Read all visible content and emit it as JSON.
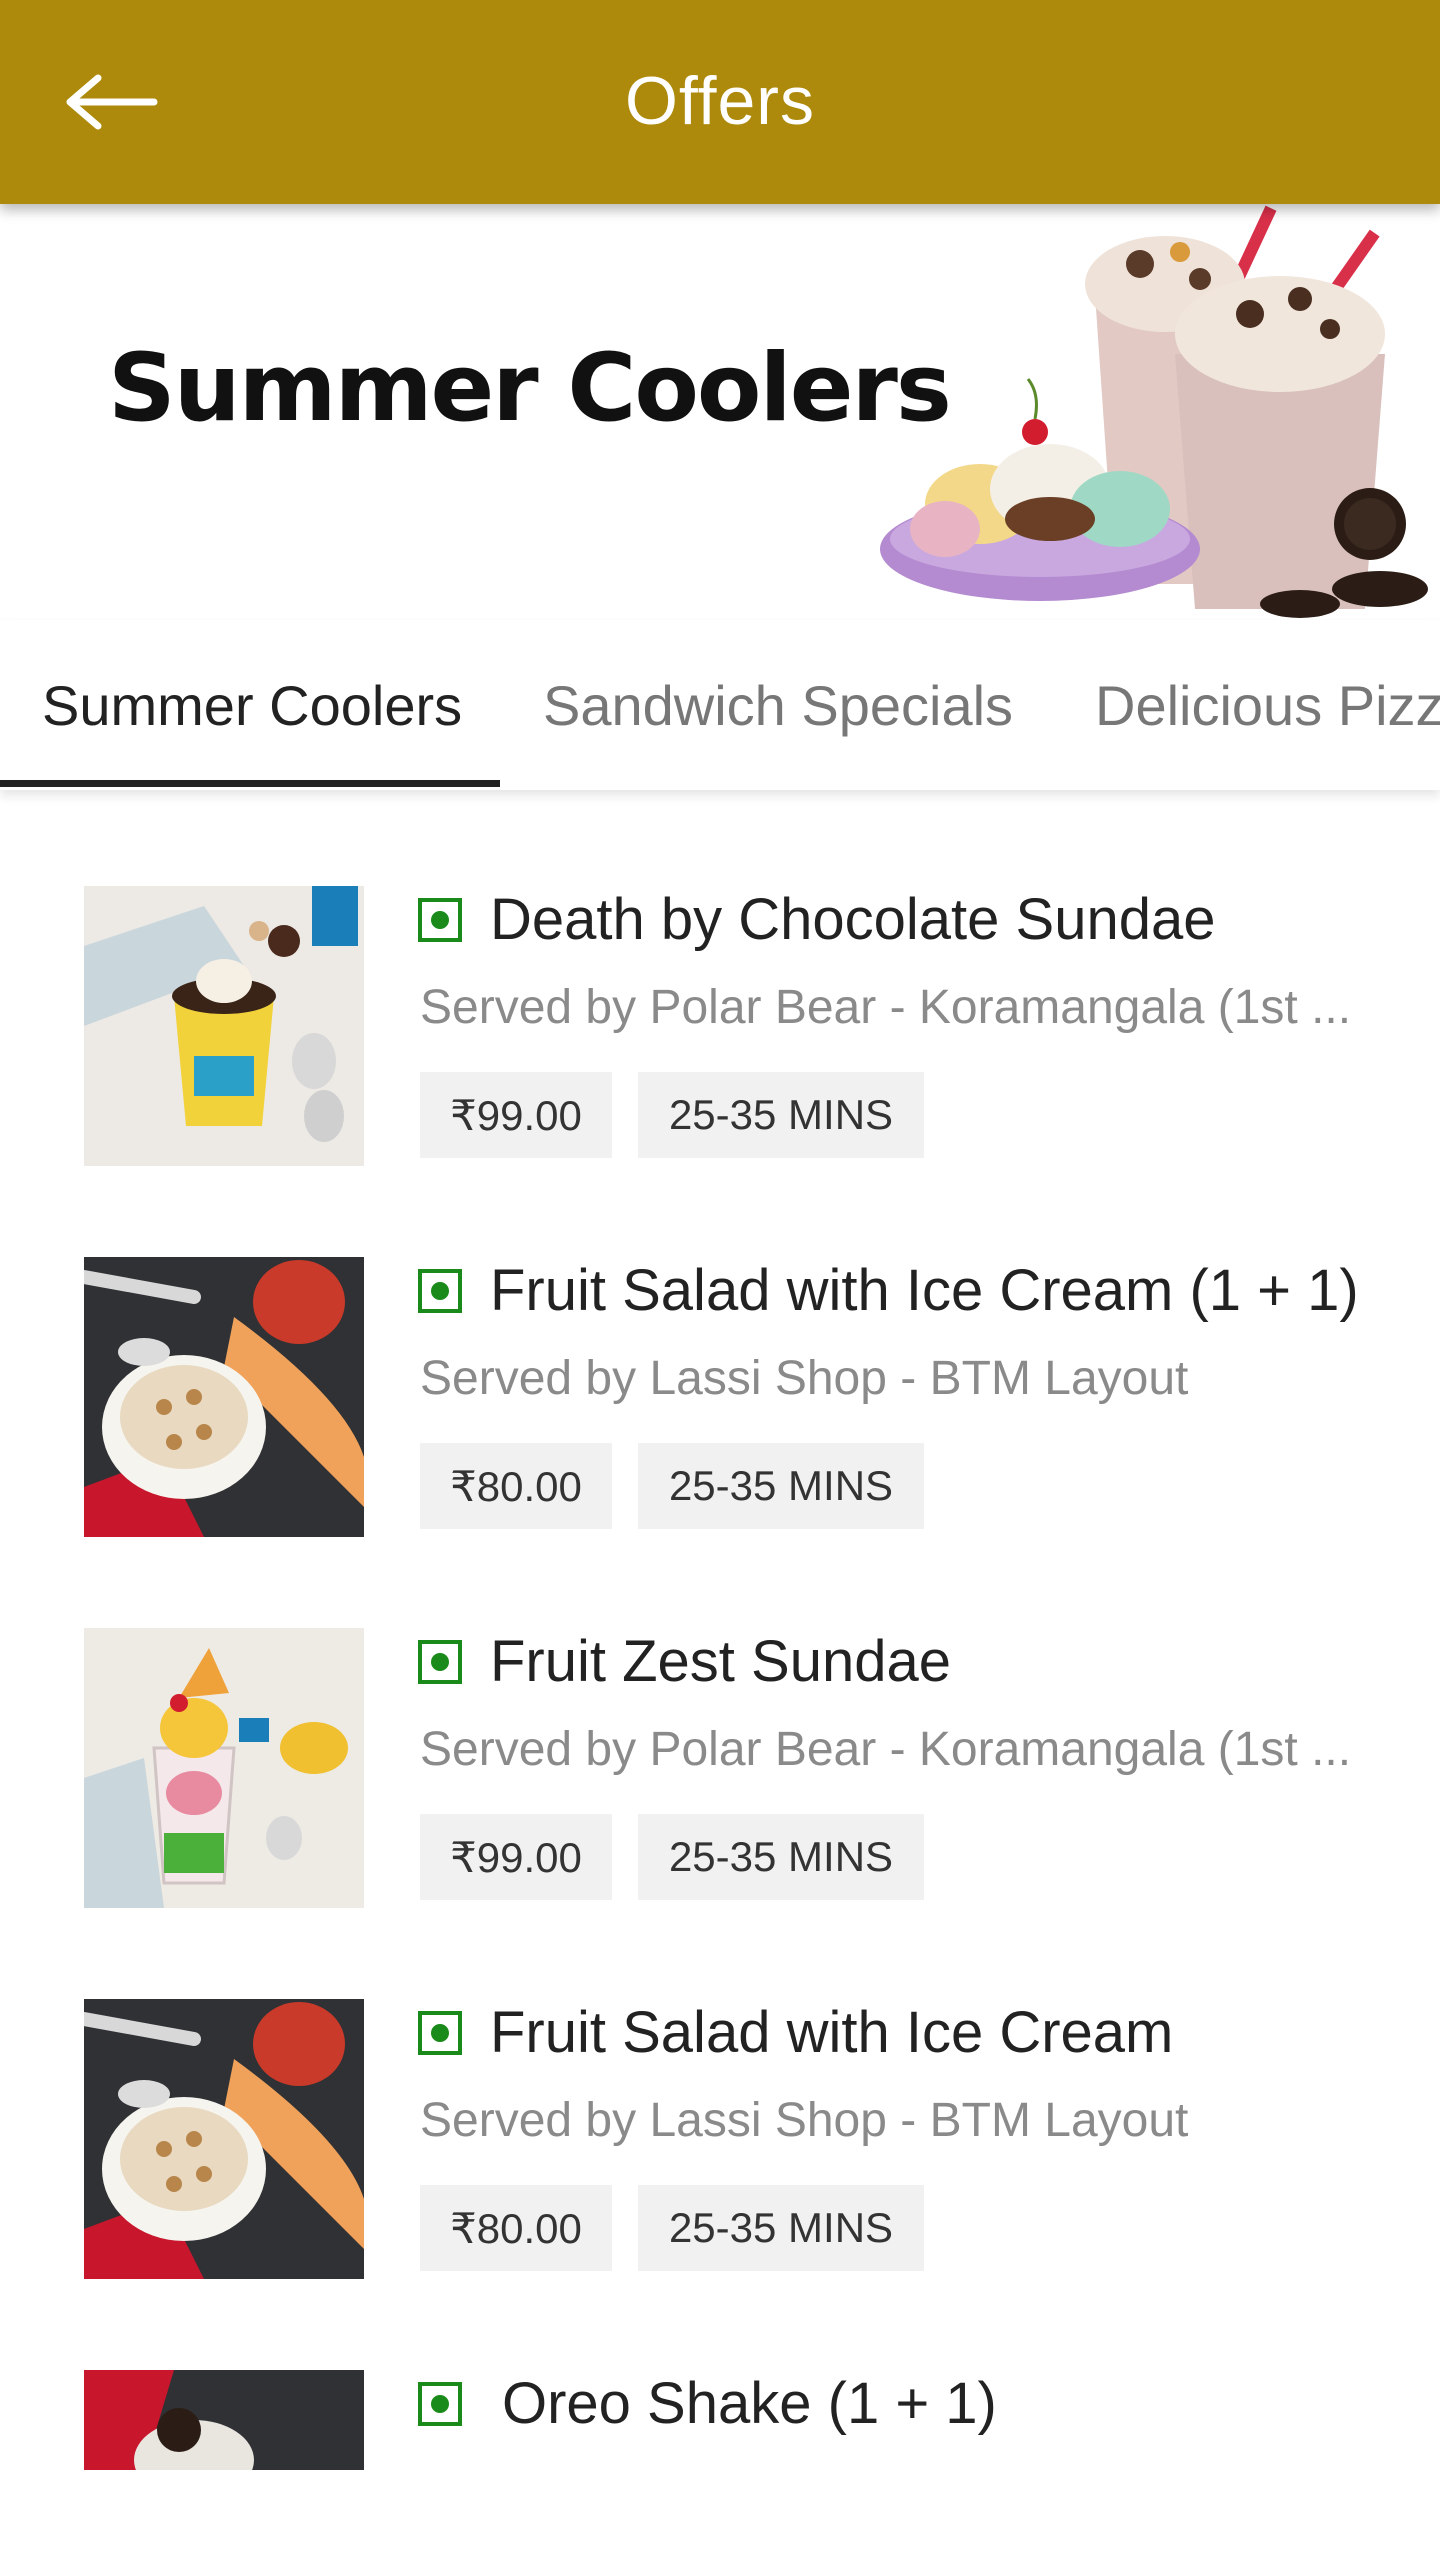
{
  "header": {
    "title": "Offers",
    "back_icon": "arrow-left-icon"
  },
  "banner": {
    "title": "Summer Coolers"
  },
  "tabs": [
    {
      "label": "Summer Coolers",
      "active": true
    },
    {
      "label": "Sandwich Specials",
      "active": false
    },
    {
      "label": "Delicious Pizz",
      "active": false
    }
  ],
  "items": [
    {
      "name": "Death by Chocolate Sundae",
      "served_by": "Served by Polar Bear - Koramangala (1st ...",
      "price": "₹99.00",
      "time": "25-35 MINS"
    },
    {
      "name": "Fruit Salad with Ice Cream (1 + 1)",
      "served_by": "Served by Lassi Shop - BTM Layout",
      "price": "₹80.00",
      "time": "25-35 MINS"
    },
    {
      "name": "Fruit Zest Sundae",
      "served_by": "Served by Polar Bear - Koramangala (1st ...",
      "price": "₹99.00",
      "time": "25-35 MINS"
    },
    {
      "name": "Fruit Salad with Ice Cream",
      "served_by": "Served by Lassi Shop - BTM Layout",
      "price": "₹80.00",
      "time": "25-35 MINS"
    },
    {
      "name": "Oreo Shake (1 + 1)"
    }
  ],
  "colors": {
    "appbar": "#ad8a0b",
    "veg": "#1a8a1a"
  }
}
